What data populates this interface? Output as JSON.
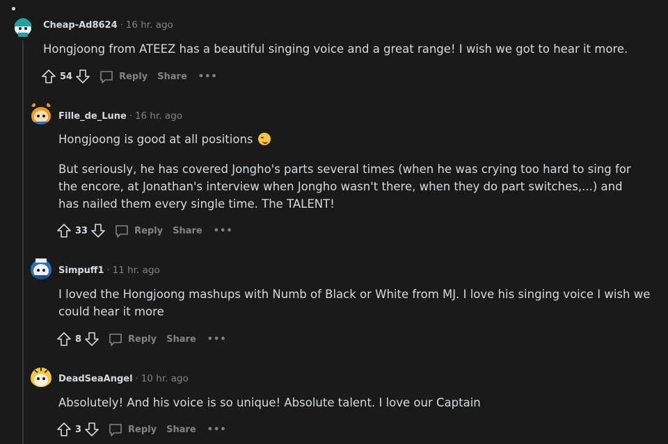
{
  "comments": [
    {
      "author": "Cheap-Ad8624",
      "time": "16 hr. ago",
      "body": [
        "Hongjoong from ATEEZ has a beautiful singing voice and a great range! I wish we got to hear it more."
      ],
      "votes": "54",
      "reply_label": "Reply",
      "share_label": "Share",
      "more_label": "•••",
      "avatar_color": "#24a0a0"
    },
    {
      "author": "Fille_de_Lune",
      "time": "16 hr. ago",
      "body": [
        "Hongjoong is good at all positions",
        "But seriously, he has covered Jongho's parts several times (when he was crying too hard to sing for the encore, at Jonathan's interview when Jongho wasn't there, when they do part switches,...) and has nailed them every single time. The TALENT!"
      ],
      "votes": "33",
      "reply_label": "Reply",
      "share_label": "Share",
      "more_label": "•••",
      "avatar_color": "#e89a2c"
    },
    {
      "author": "Simpuff1",
      "time": "11 hr. ago",
      "body": [
        "I loved the Hongjoong mashups with Numb of Black or White from MJ. I love his singing voice I wish we could hear it more"
      ],
      "votes": "8",
      "reply_label": "Reply",
      "share_label": "Share",
      "more_label": "•••",
      "avatar_color": "#2f6db5"
    },
    {
      "author": "DeadSeaAngel",
      "time": "10 hr. ago",
      "body": [
        "Absolutely! And his voice is so unique! Absolute talent. I love our Captain"
      ],
      "votes": "3",
      "reply_label": "Reply",
      "share_label": "Share",
      "more_label": "•••",
      "avatar_color": "#f2c84b"
    }
  ],
  "separator": "·",
  "colors": {
    "background": "#1a1a1b",
    "text": "#d7dadc",
    "muted": "#818384",
    "thread_line": "#343536"
  }
}
